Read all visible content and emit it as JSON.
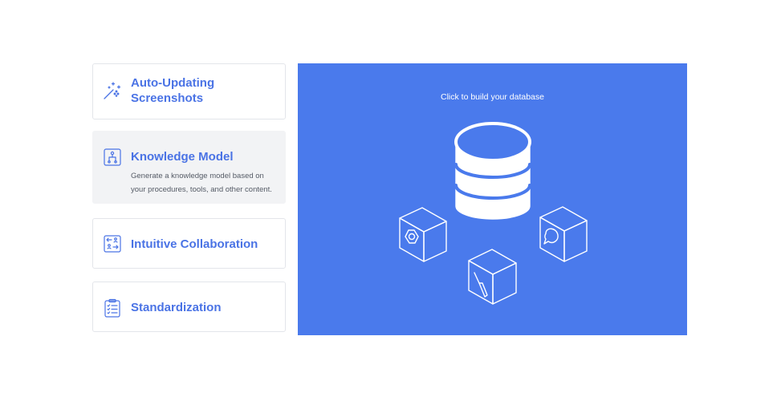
{
  "features": [
    {
      "title": "Auto-Updating Screenshots",
      "icon": "magic-wand-icon",
      "description": ""
    },
    {
      "title": "Knowledge Model",
      "icon": "knowledge-model-icon",
      "description": "Generate a knowledge model based on your procedures, tools, and other content."
    },
    {
      "title": "Intuitive Collaboration",
      "icon": "collaboration-icon",
      "description": ""
    },
    {
      "title": "Standardization",
      "icon": "checklist-icon",
      "description": ""
    }
  ],
  "active_feature_index": 1,
  "panel": {
    "caption": "Click to build your database",
    "illustration": [
      "database-icon",
      "nut-cube-icon",
      "screwdriver-cube-icon",
      "chat-bubble-cube-icon"
    ]
  },
  "colors": {
    "accent": "#4a73e5",
    "panel_background": "#4a7aec",
    "active_card": "#f2f3f5"
  }
}
